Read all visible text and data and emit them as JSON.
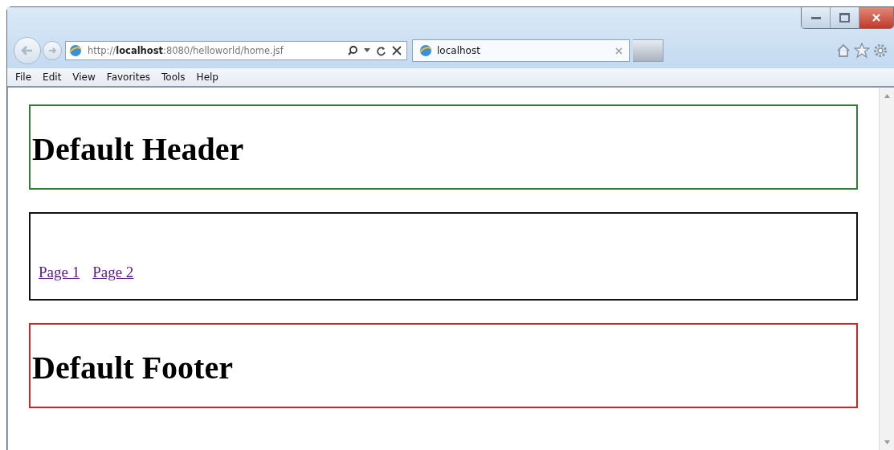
{
  "browser": {
    "address": {
      "prefix": "http://",
      "host": "localhost",
      "rest": ":8080/helloworld/home.jsf"
    },
    "tabs": [
      {
        "label": "localhost",
        "selected": true
      }
    ],
    "menu": [
      "File",
      "Edit",
      "View",
      "Favorites",
      "Tools",
      "Help"
    ]
  },
  "page": {
    "sections": [
      {
        "kind": "heading",
        "color": "#2e7d32",
        "text": "Default Header"
      },
      {
        "kind": "links",
        "color": "#111111",
        "links": [
          "Page 1",
          "Page 2"
        ]
      },
      {
        "kind": "heading",
        "color": "#c62828",
        "text": "Default Footer"
      }
    ]
  }
}
